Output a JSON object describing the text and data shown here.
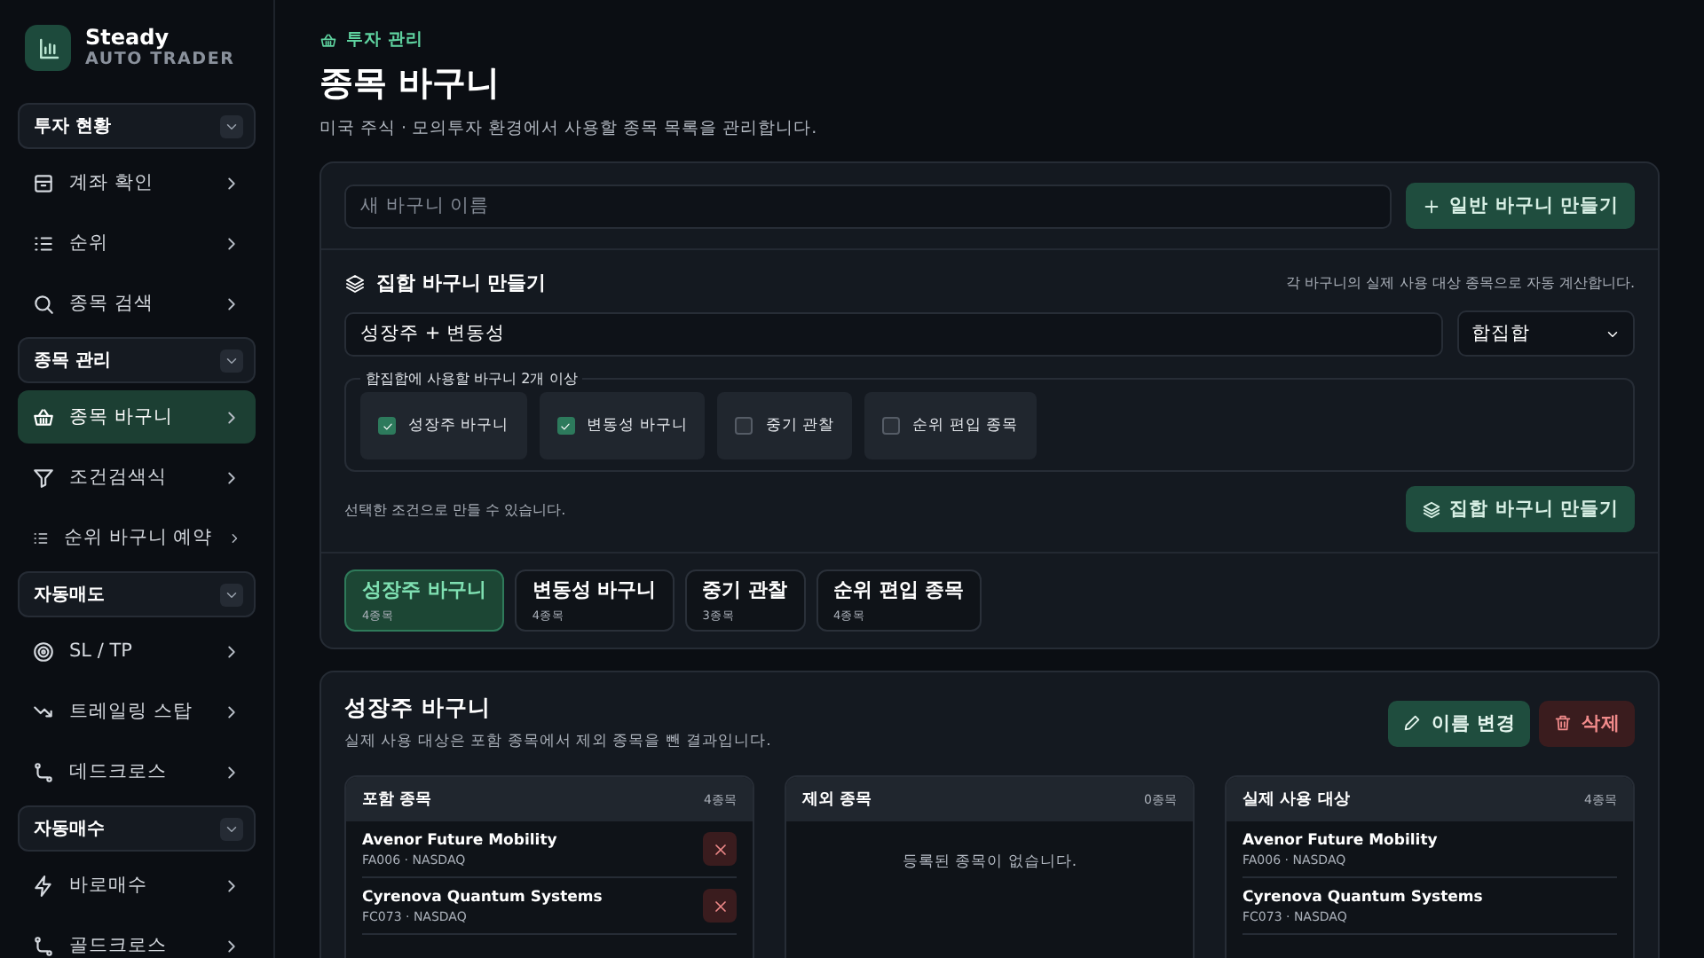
{
  "brand": {
    "name": "Steady",
    "subtitle": "AUTO TRADER"
  },
  "sidebar": {
    "groups": [
      {
        "label": "투자 현황",
        "expanded": true,
        "items": [
          {
            "label": "계좌 확인",
            "selected": false
          },
          {
            "label": "순위",
            "selected": false
          },
          {
            "label": "종목 검색",
            "selected": false
          }
        ]
      },
      {
        "label": "종목 관리",
        "expanded": true,
        "items": [
          {
            "label": "종목 바구니",
            "selected": true
          },
          {
            "label": "조건검색식",
            "selected": false
          },
          {
            "label": "순위 바구니 예약",
            "selected": false
          }
        ]
      },
      {
        "label": "자동매도",
        "expanded": true,
        "items": [
          {
            "label": "SL / TP",
            "selected": false
          },
          {
            "label": "트레일링 스탑",
            "selected": false
          },
          {
            "label": "데드크로스",
            "selected": false
          }
        ]
      },
      {
        "label": "자동매수",
        "expanded": true,
        "items": [
          {
            "label": "바로매수",
            "selected": false
          },
          {
            "label": "골드크로스",
            "selected": false
          }
        ]
      }
    ]
  },
  "header": {
    "breadcrumb": "투자 관리",
    "title": "종목 바구니",
    "description": "미국 주식 · 모의투자 환경에서 사용할 종목 목록을 관리합니다."
  },
  "create": {
    "name_field": {
      "placeholder": "새 바구니 이름"
    },
    "create_button": "일반 바구니 만들기",
    "combo": {
      "title": "집합 바구니 만들기",
      "note": "각 바구니의 실제 사용 대상 종목으로 자동 계산합니다.",
      "name_value": "성장주 + 변동성",
      "operation": "합집합",
      "legend": "합집합에 사용할 바구니 2개 이상",
      "options": [
        {
          "label": "성장주 바구니",
          "checked": true
        },
        {
          "label": "변동성 바구니",
          "checked": true
        },
        {
          "label": "중기 관찰",
          "checked": false
        },
        {
          "label": "순위 편입 종목",
          "checked": false
        }
      ],
      "hint": "선택한 조건으로 만들 수 있습니다.",
      "button": "집합 바구니 만들기"
    }
  },
  "baskets": [
    {
      "name": "성장주 바구니",
      "count": "4종목",
      "selected": true
    },
    {
      "name": "변동성 바구니",
      "count": "4종목",
      "selected": false
    },
    {
      "name": "중기 관찰",
      "count": "3종목",
      "selected": false
    },
    {
      "name": "순위 편입 종목",
      "count": "4종목",
      "selected": false
    }
  ],
  "detail": {
    "title": "성장주 바구니",
    "description": "실제 사용 대상은 포함 종목에서 제외 종목을 뺀 결과입니다.",
    "rename_button": "이름 변경",
    "delete_button": "삭제",
    "columns": [
      {
        "title": "포함 종목",
        "count": "4종목",
        "kind": "removable",
        "items": [
          {
            "name": "Avenor Future Mobility",
            "meta": "FA006 · NASDAQ"
          },
          {
            "name": "Cyrenova Quantum Systems",
            "meta": "FC073 · NASDAQ"
          }
        ]
      },
      {
        "title": "제외 종목",
        "count": "0종목",
        "kind": "empty",
        "empty_text": "등록된 종목이 없습니다."
      },
      {
        "title": "실제 사용 대상",
        "count": "4종목",
        "kind": "plain",
        "items": [
          {
            "name": "Avenor Future Mobility",
            "meta": "FA006 · NASDAQ"
          },
          {
            "name": "Cyrenova Quantum Systems",
            "meta": "FC073 · NASDAQ"
          }
        ]
      }
    ]
  }
}
